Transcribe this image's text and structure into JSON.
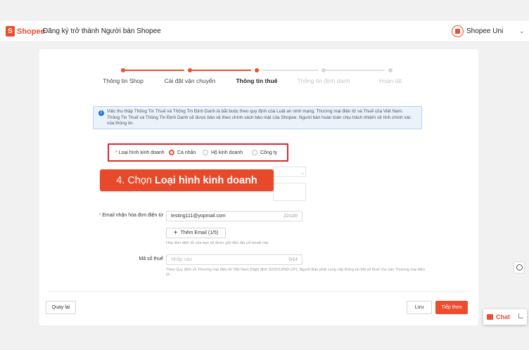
{
  "header": {
    "logo_glyph": "S",
    "logo_text": "Shopee",
    "page_title": "Đăng ký trở thành Người bán Shopee",
    "uni_label": "Shopee Uni",
    "chevron": "⌄"
  },
  "steps": [
    {
      "label": "Thông tin Shop",
      "state": "done"
    },
    {
      "label": "Cài đặt vận chuyển",
      "state": "done"
    },
    {
      "label": "Thông tin thuế",
      "state": "active"
    },
    {
      "label": "Thông tin định danh",
      "state": "pending"
    },
    {
      "label": "Hoàn tất",
      "state": "pending"
    }
  ],
  "info": {
    "icon_glyph": "i",
    "text": "Việc thu thập Thông Tin Thuế và Thông Tin Định Danh là bắt buộc theo quy định của Luật an ninh mạng, Thương mại điện tử và Thuế của Việt Nam. Thông Tin Thuế và Thông Tin Định Danh sẽ được bảo vệ theo chính sách bảo mật của Shopee. Người bán hoàn toàn chịu trách nhiệm về tính chính xác của thông tin."
  },
  "business_type": {
    "required_mark": "*",
    "label": "Loại hình kinh doanh",
    "options": [
      "Cá nhân",
      "Hộ kinh doanh",
      "Công ty"
    ],
    "selected": "Cá nhân"
  },
  "banner": {
    "prefix": "4. Chọn",
    "emphasis": "Loại hình kinh doanh"
  },
  "email": {
    "required_mark": "*",
    "label": "Email nhận hóa đơn điện tử",
    "value": "testing111@yopmail.com",
    "counter": "22/100",
    "add_plus": "+",
    "add_label": "Thêm Email (1/5)",
    "hint": "Hóa đơn điện tử của bạn sẽ được gửi đến địa chỉ email này"
  },
  "tax": {
    "label": "Mã số thuế",
    "placeholder": "Nhập vào",
    "counter": "0/14",
    "hint": "Theo Quy định về Thương mại điện tử Việt Nam (Nghị định 52/2013/ND-CP), Người Bán phải cung cấp thông tin Mã số thuế cho sàn Thương mại điện tử."
  },
  "footer": {
    "back_label": "Quay lại",
    "save_label": "Lưu",
    "next_label": "Tiếp theo"
  },
  "chat": {
    "label": "Chat"
  },
  "colors": {
    "brand": "#ee4d2d",
    "highlight_border": "#e3262d",
    "info_bg": "#eaf2fb"
  }
}
